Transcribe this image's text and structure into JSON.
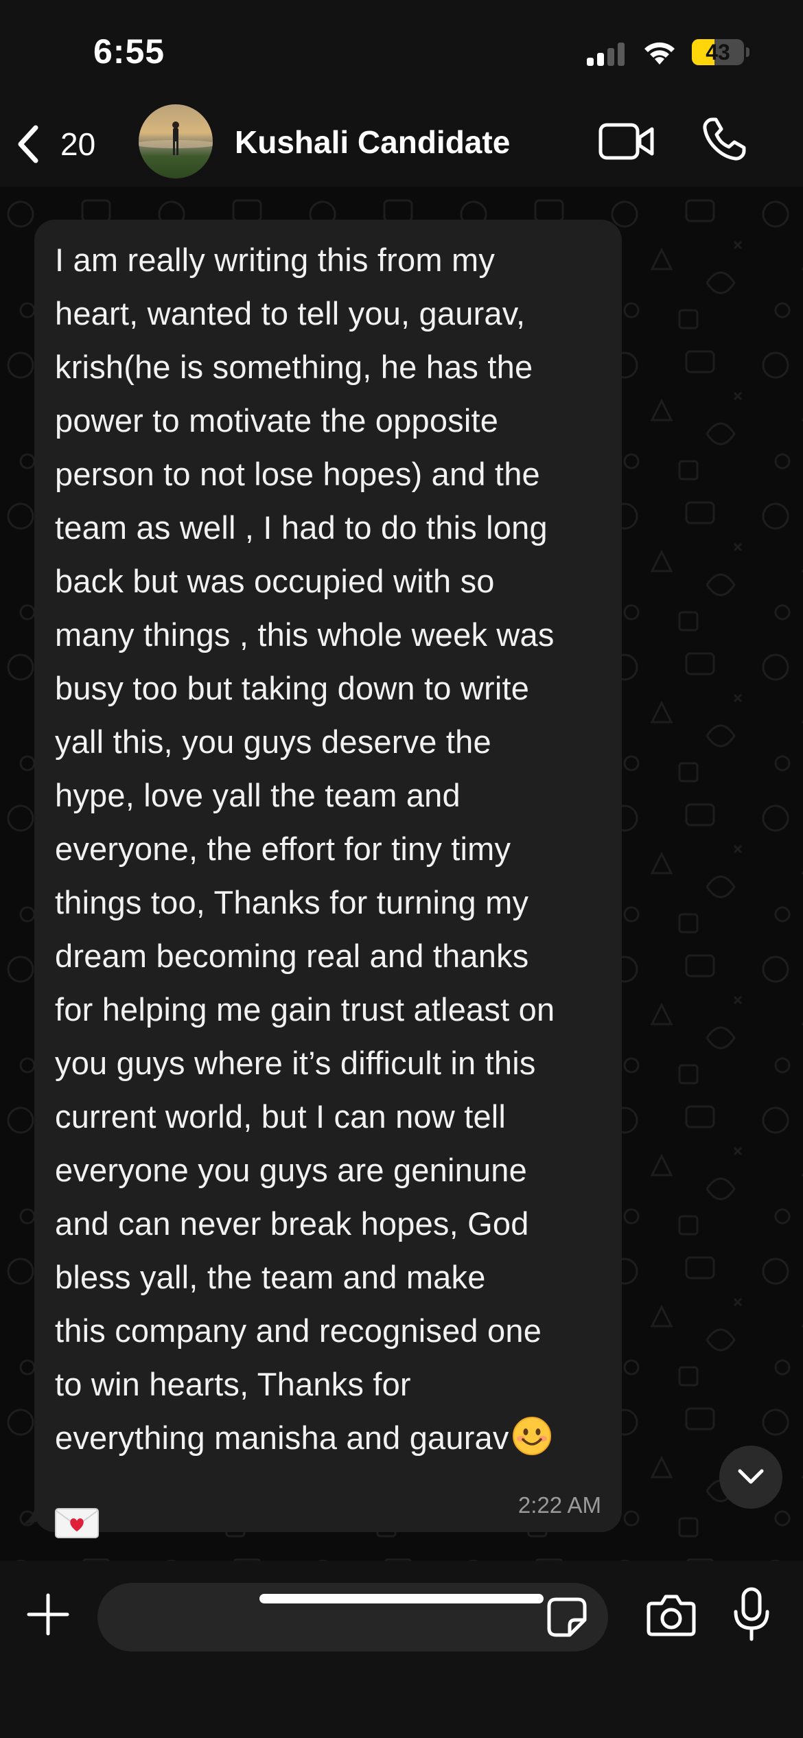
{
  "status_bar": {
    "time": "6:55",
    "battery_level": "43",
    "battery_color": "#ffd60a",
    "signal_icon": "cellular-signal-icon",
    "wifi_icon": "wifi-icon"
  },
  "header": {
    "back_count": "20",
    "contact_name": "Kushali Candidate",
    "video_icon": "video-call-icon",
    "call_icon": "phone-call-icon"
  },
  "message": {
    "text": "I am really writing this from my\nheart, wanted to tell you, gaurav,\nkrish(he is something, he has the\npower to motivate the opposite\nperson to not lose hopes) and the\nteam as well , I had to do this long\nback but was occupied with so\nmany things , this whole week was\nbusy too but taking down to write\nyall this, you guys deserve the\nhype, love yall the team and\neveryone, the effort for tiny timy\nthings too, Thanks for turning my\ndream becoming real and thanks\nfor helping me gain trust atleast on\nyou guys where it’s difficult in this\ncurrent world, but I can now tell\neveryone you guys are geninune\nand can never break hopes, God\nbless yall, the team and make\nthis company and recognised one\nto win hearts, Thanks for\neverything manisha and gaurav",
    "emojis": [
      "smiling-face-emoji",
      "love-letter-emoji"
    ],
    "time": "2:22 AM",
    "bubble_color": "#1f1f1f"
  },
  "input_bar": {
    "placeholder": "",
    "plus_icon": "plus-icon",
    "sticker_icon": "sticker-icon",
    "camera_icon": "camera-icon",
    "mic_icon": "microphone-icon"
  },
  "scroll_down_icon": "chevron-down-icon"
}
